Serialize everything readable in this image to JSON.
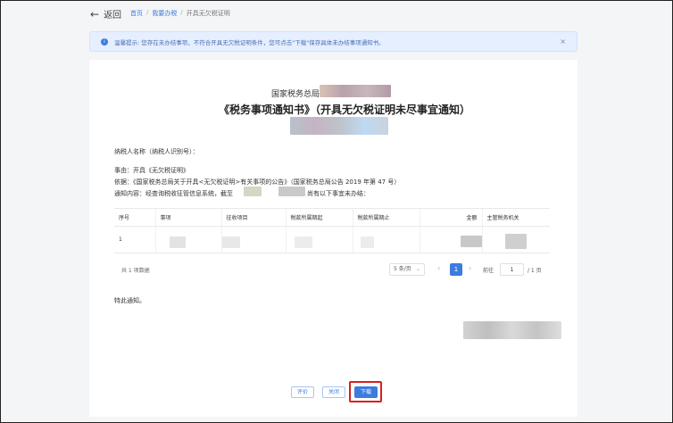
{
  "header": {
    "back_label": "返回",
    "breadcrumbs": [
      "首页",
      "我要办税",
      "开具无欠税证明"
    ]
  },
  "notice": {
    "text": "温馨提示: 您存在未办结事项，不符合开具无欠税证明条件，您可点击\"下载\"保存具体未办结事项通知书。",
    "close_icon": "close-icon"
  },
  "document": {
    "authority": "国家税务总局",
    "title": "《税务事项通知书》（开具无欠税证明未尽事宜通知）",
    "taxpayer_line": "纳税人名称（纳税人识别号）：",
    "subject_line": "事由：开具《无欠税证明》",
    "basis_line": "依据：《国家税务总局关于开具<无欠税证明>有关事项的公告》（国家税务总局公告 2019 年第 47 号）",
    "content_prefix": "通知内容：经查询税收征管信息系统，截至",
    "content_suffix": "尚有以下事宜未办结：",
    "closing": "特此通知。"
  },
  "table": {
    "columns": [
      "序号",
      "事项",
      "征收项目",
      "税款所属期起",
      "税款所属期止",
      "金额",
      "主管税务机关"
    ],
    "rows": [
      [
        "1",
        "",
        "",
        "",
        "",
        "",
        ""
      ]
    ]
  },
  "pagination": {
    "total": "共 1 项数据",
    "page_size": "5 条/页",
    "current_page": "1",
    "goto_label": "前往",
    "goto_value": "1",
    "total_pages": "/ 1 页"
  },
  "actions": {
    "preview": "评价",
    "close": "关闭",
    "download": "下载"
  },
  "colors": {
    "accent": "#3d7be0",
    "highlight": "#d9201b",
    "notice_bg": "#e6efff"
  }
}
